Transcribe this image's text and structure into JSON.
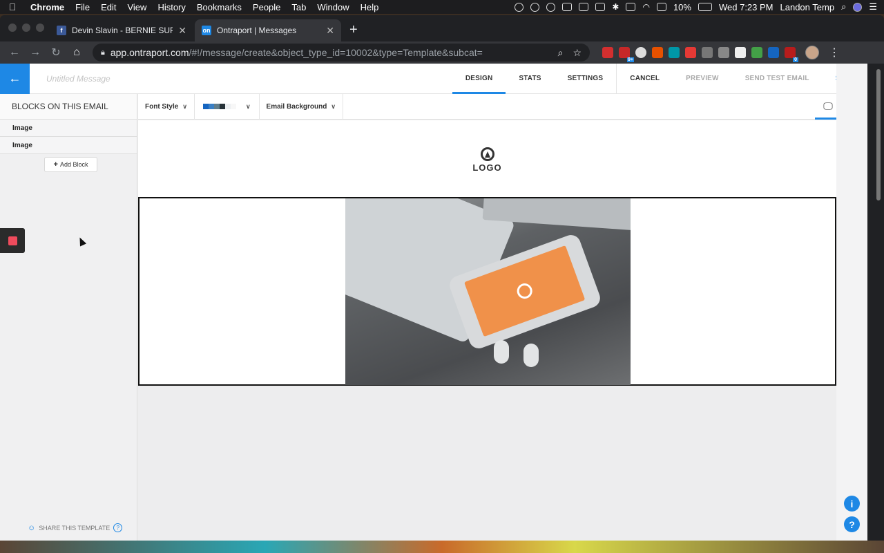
{
  "menubar": {
    "app": "Chrome",
    "items": [
      "File",
      "Edit",
      "View",
      "History",
      "Bookmarks",
      "People",
      "Tab",
      "Window",
      "Help"
    ],
    "battery": "10%",
    "clock": "Wed 7:23 PM",
    "user": "Landon Temp"
  },
  "tabs": [
    {
      "title": "Devin Slavin - BERNIE SUPPOR",
      "favicon": "facebook-icon",
      "favicon_color": "#3b5998"
    },
    {
      "title": "Ontraport | Messages",
      "favicon": "ontraport-icon",
      "favicon_color": "#1e88e5",
      "fav_text": "on"
    }
  ],
  "omnibox": {
    "host": "app.ontraport.com",
    "path": "/#!/message/create&object_type_id=10002&type=Template&subcat="
  },
  "extension_badges": {
    "a": "9+",
    "b": "0"
  },
  "app": {
    "title_placeholder": "Untitled Message",
    "nav": {
      "design": "DESIGN",
      "stats": "STATS",
      "settings": "SETTINGS",
      "cancel": "CANCEL",
      "preview": "PREVIEW",
      "send_test": "SEND TEST EMAIL",
      "save": "SAVE"
    },
    "sidebar": {
      "heading": "BLOCKS ON THIS EMAIL",
      "blocks": [
        "Image",
        "Image"
      ],
      "add_block": "Add Block",
      "share": "SHARE THIS TEMPLATE",
      "help": "?"
    },
    "options": {
      "font_style": "Font Style",
      "email_background": "Email Background",
      "palette": [
        "#1565c0",
        "#3a7fc4",
        "#607d8b",
        "#263238",
        "#eceff1",
        "#ffffff"
      ]
    },
    "canvas": {
      "logo_text": "LOGO"
    },
    "fabs": {
      "info": "i",
      "help": "?"
    }
  },
  "colors": {
    "accent": "#1e88e5",
    "red_widget": "#ef4b5c"
  }
}
